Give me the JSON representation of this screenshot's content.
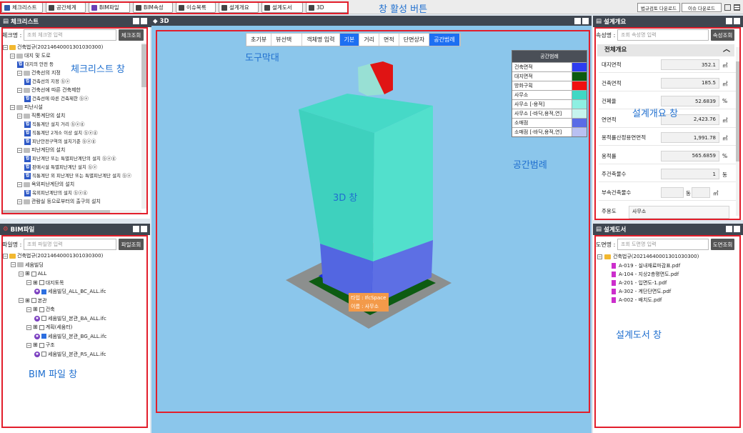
{
  "toolbar": {
    "buttons": [
      {
        "label": "체크리스트",
        "color": "#2e5ba8"
      },
      {
        "label": "공간체계",
        "color": "#444"
      },
      {
        "label": "BIM파일",
        "color": "#6a3fb5"
      },
      {
        "label": "BIM속성",
        "color": "#444"
      },
      {
        "label": "이슈목록",
        "color": "#444"
      },
      {
        "label": "설계개요",
        "color": "#444"
      },
      {
        "label": "설계도서",
        "color": "#444"
      },
      {
        "label": "3D",
        "color": "#444"
      }
    ],
    "right_buttons": [
      "법규검토 다운로드",
      "이슈 다운로드"
    ]
  },
  "annotations": {
    "toolbar_btn": "창 활성 버튼",
    "checklist": "체크리스트 창",
    "bimfile": "BIM 파일 창",
    "toolstrip": "도구막대",
    "view3d": "3D 창",
    "legend": "공간범례",
    "overview": "설계개요 창",
    "drawings": "설계도서 창"
  },
  "checklist": {
    "title": "체크리스트",
    "search_label": "체크명 :",
    "search_placeholder": "조회 체크명 입력",
    "search_btn": "체크조회",
    "items": [
      {
        "text": "건축법규(20214640001301030300)",
        "lvl": 0,
        "type": "root"
      },
      {
        "text": "대지 및 도로",
        "lvl": 1,
        "type": "folder"
      },
      {
        "text": "대지의 안전 등",
        "lvl": 2,
        "type": "leaf"
      },
      {
        "text": "건축선의 지정",
        "lvl": 2,
        "type": "folder"
      },
      {
        "text": "건축선의 지정 ⓑⓔ",
        "lvl": 3,
        "type": "leaf"
      },
      {
        "text": "건축선에 따른 건축제한",
        "lvl": 2,
        "type": "folder"
      },
      {
        "text": "건축선에 따른 건축제한 ⓑⓔ",
        "lvl": 3,
        "type": "leaf"
      },
      {
        "text": "피난시설",
        "lvl": 1,
        "type": "folder"
      },
      {
        "text": "직통계단의 설치",
        "lvl": 2,
        "type": "folder"
      },
      {
        "text": "직통계단 설치 거리 ⓑⓔⓖ",
        "lvl": 3,
        "type": "leaf"
      },
      {
        "text": "직통계단 2개소 이상 설치 ⓑⓔⓖ",
        "lvl": 3,
        "type": "leaf"
      },
      {
        "text": "피난안전구역의 설치기준 ⓑⓔⓖ",
        "lvl": 3,
        "type": "leaf"
      },
      {
        "text": "피난계단의 설치",
        "lvl": 2,
        "type": "folder"
      },
      {
        "text": "피난계단 또는 특별피난계단의 설치 ⓑⓔⓖ",
        "lvl": 3,
        "type": "leaf"
      },
      {
        "text": "판매시설 특별피난계단 설치 ⓑⓔ",
        "lvl": 3,
        "type": "leaf"
      },
      {
        "text": "직통계단 외 피난계단 또는 특별피난계단 설치 ⓑⓔ",
        "lvl": 3,
        "type": "leaf"
      },
      {
        "text": "옥외피난계단의 설치",
        "lvl": 2,
        "type": "folder"
      },
      {
        "text": "옥외피난계단의 설치 ⓑⓔⓖ",
        "lvl": 3,
        "type": "leaf"
      },
      {
        "text": "관람실 등으로부터의 출구의 설치",
        "lvl": 2,
        "type": "folder"
      }
    ]
  },
  "bimfile": {
    "title": "BIM파일",
    "search_label": "파일명 :",
    "search_placeholder": "조회 파일명 입력",
    "search_btn": "파일조회",
    "items": [
      {
        "text": "건축법규(20214640001301030300)",
        "lvl": 0,
        "type": "root"
      },
      {
        "text": "세움빌딩",
        "lvl": 1,
        "type": "gfolder"
      },
      {
        "text": "ALL",
        "lvl": 2,
        "type": "grp"
      },
      {
        "text": "대지토목",
        "lvl": 3,
        "type": "grp"
      },
      {
        "text": "세움빌딩_ALL_BC_ALL.ifc",
        "lvl": 4,
        "type": "file",
        "checked": true
      },
      {
        "text": "본관",
        "lvl": 2,
        "type": "grp"
      },
      {
        "text": "건축",
        "lvl": 3,
        "type": "grp"
      },
      {
        "text": "세움빌딩_본관_BA_ALL.ifc",
        "lvl": 4,
        "type": "file",
        "checked": false
      },
      {
        "text": "계획(세움터)",
        "lvl": 3,
        "type": "grp"
      },
      {
        "text": "세움빌딩_본관_BG_ALL.ifc",
        "lvl": 4,
        "type": "file",
        "checked": true
      },
      {
        "text": "구조",
        "lvl": 3,
        "type": "grp"
      },
      {
        "text": "세움빌딩_본관_RS_ALL.ifc",
        "lvl": 4,
        "type": "file",
        "checked": false
      }
    ]
  },
  "view3d": {
    "title": "3D",
    "tools": [
      "초기뷰",
      "뷰선택",
      "객체명 입력",
      "기본",
      "거리",
      "면적",
      "단면상자",
      "공간범례"
    ],
    "tooltip": [
      "타입 : IfcSpace",
      "이름 : 사무소"
    ]
  },
  "legend": {
    "title": "공간범례",
    "items": [
      {
        "name": "건축면적",
        "color": "#2e3cf0"
      },
      {
        "name": "대지면적",
        "color": "#0b5a10"
      },
      {
        "name": "방화구획",
        "color": "#f01010"
      },
      {
        "name": "사무소",
        "color": "#3fd8c4"
      },
      {
        "name": "사무소 [-용적]",
        "color": "#8ef0e2"
      },
      {
        "name": "사무소 [-바닥,용적,연]",
        "color": "#c6f4ee"
      },
      {
        "name": "소매점",
        "color": "#5a6be6"
      },
      {
        "name": "소매점 [-바닥,용적,연]",
        "color": "#b9c0f2"
      }
    ]
  },
  "overview": {
    "title": "설계개요",
    "search_label": "속성명 :",
    "search_placeholder": "조회 속성명 입력",
    "search_btn": "속성조회",
    "section": "전체개요",
    "rows": [
      {
        "label": "대지면적",
        "value": "352.1",
        "unit": "㎡"
      },
      {
        "label": "건축면적",
        "value": "185.5",
        "unit": "㎡"
      },
      {
        "label": "건폐율",
        "value": "52.6839",
        "unit": "%"
      },
      {
        "label": "연면적",
        "value": "2,423.76",
        "unit": "㎡"
      },
      {
        "label": "용적률산정용연면적",
        "value": "1,991.78",
        "unit": "㎡"
      },
      {
        "label": "용적률",
        "value": "565.6859",
        "unit": "%"
      },
      {
        "label": "주건축물수",
        "value": "1",
        "unit": "동"
      },
      {
        "label": "부속건축물수",
        "value": "",
        "unit": "동"
      }
    ],
    "last_label": "주용도",
    "last_value": "사무소"
  },
  "drawings": {
    "title": "설계도서",
    "search_label": "도면명 :",
    "search_placeholder": "조회 도면명 입력",
    "search_btn": "도면조회",
    "root": "건축법규(20214640001301030300)",
    "files": [
      "A-019 - 실내재료마감표.pdf",
      "A-104 - 지상2층평면도.pdf",
      "A-201 - 입면도-1.pdf",
      "A-302 - 계단단면도.pdf",
      "A-002 - 배치도.pdf"
    ]
  }
}
